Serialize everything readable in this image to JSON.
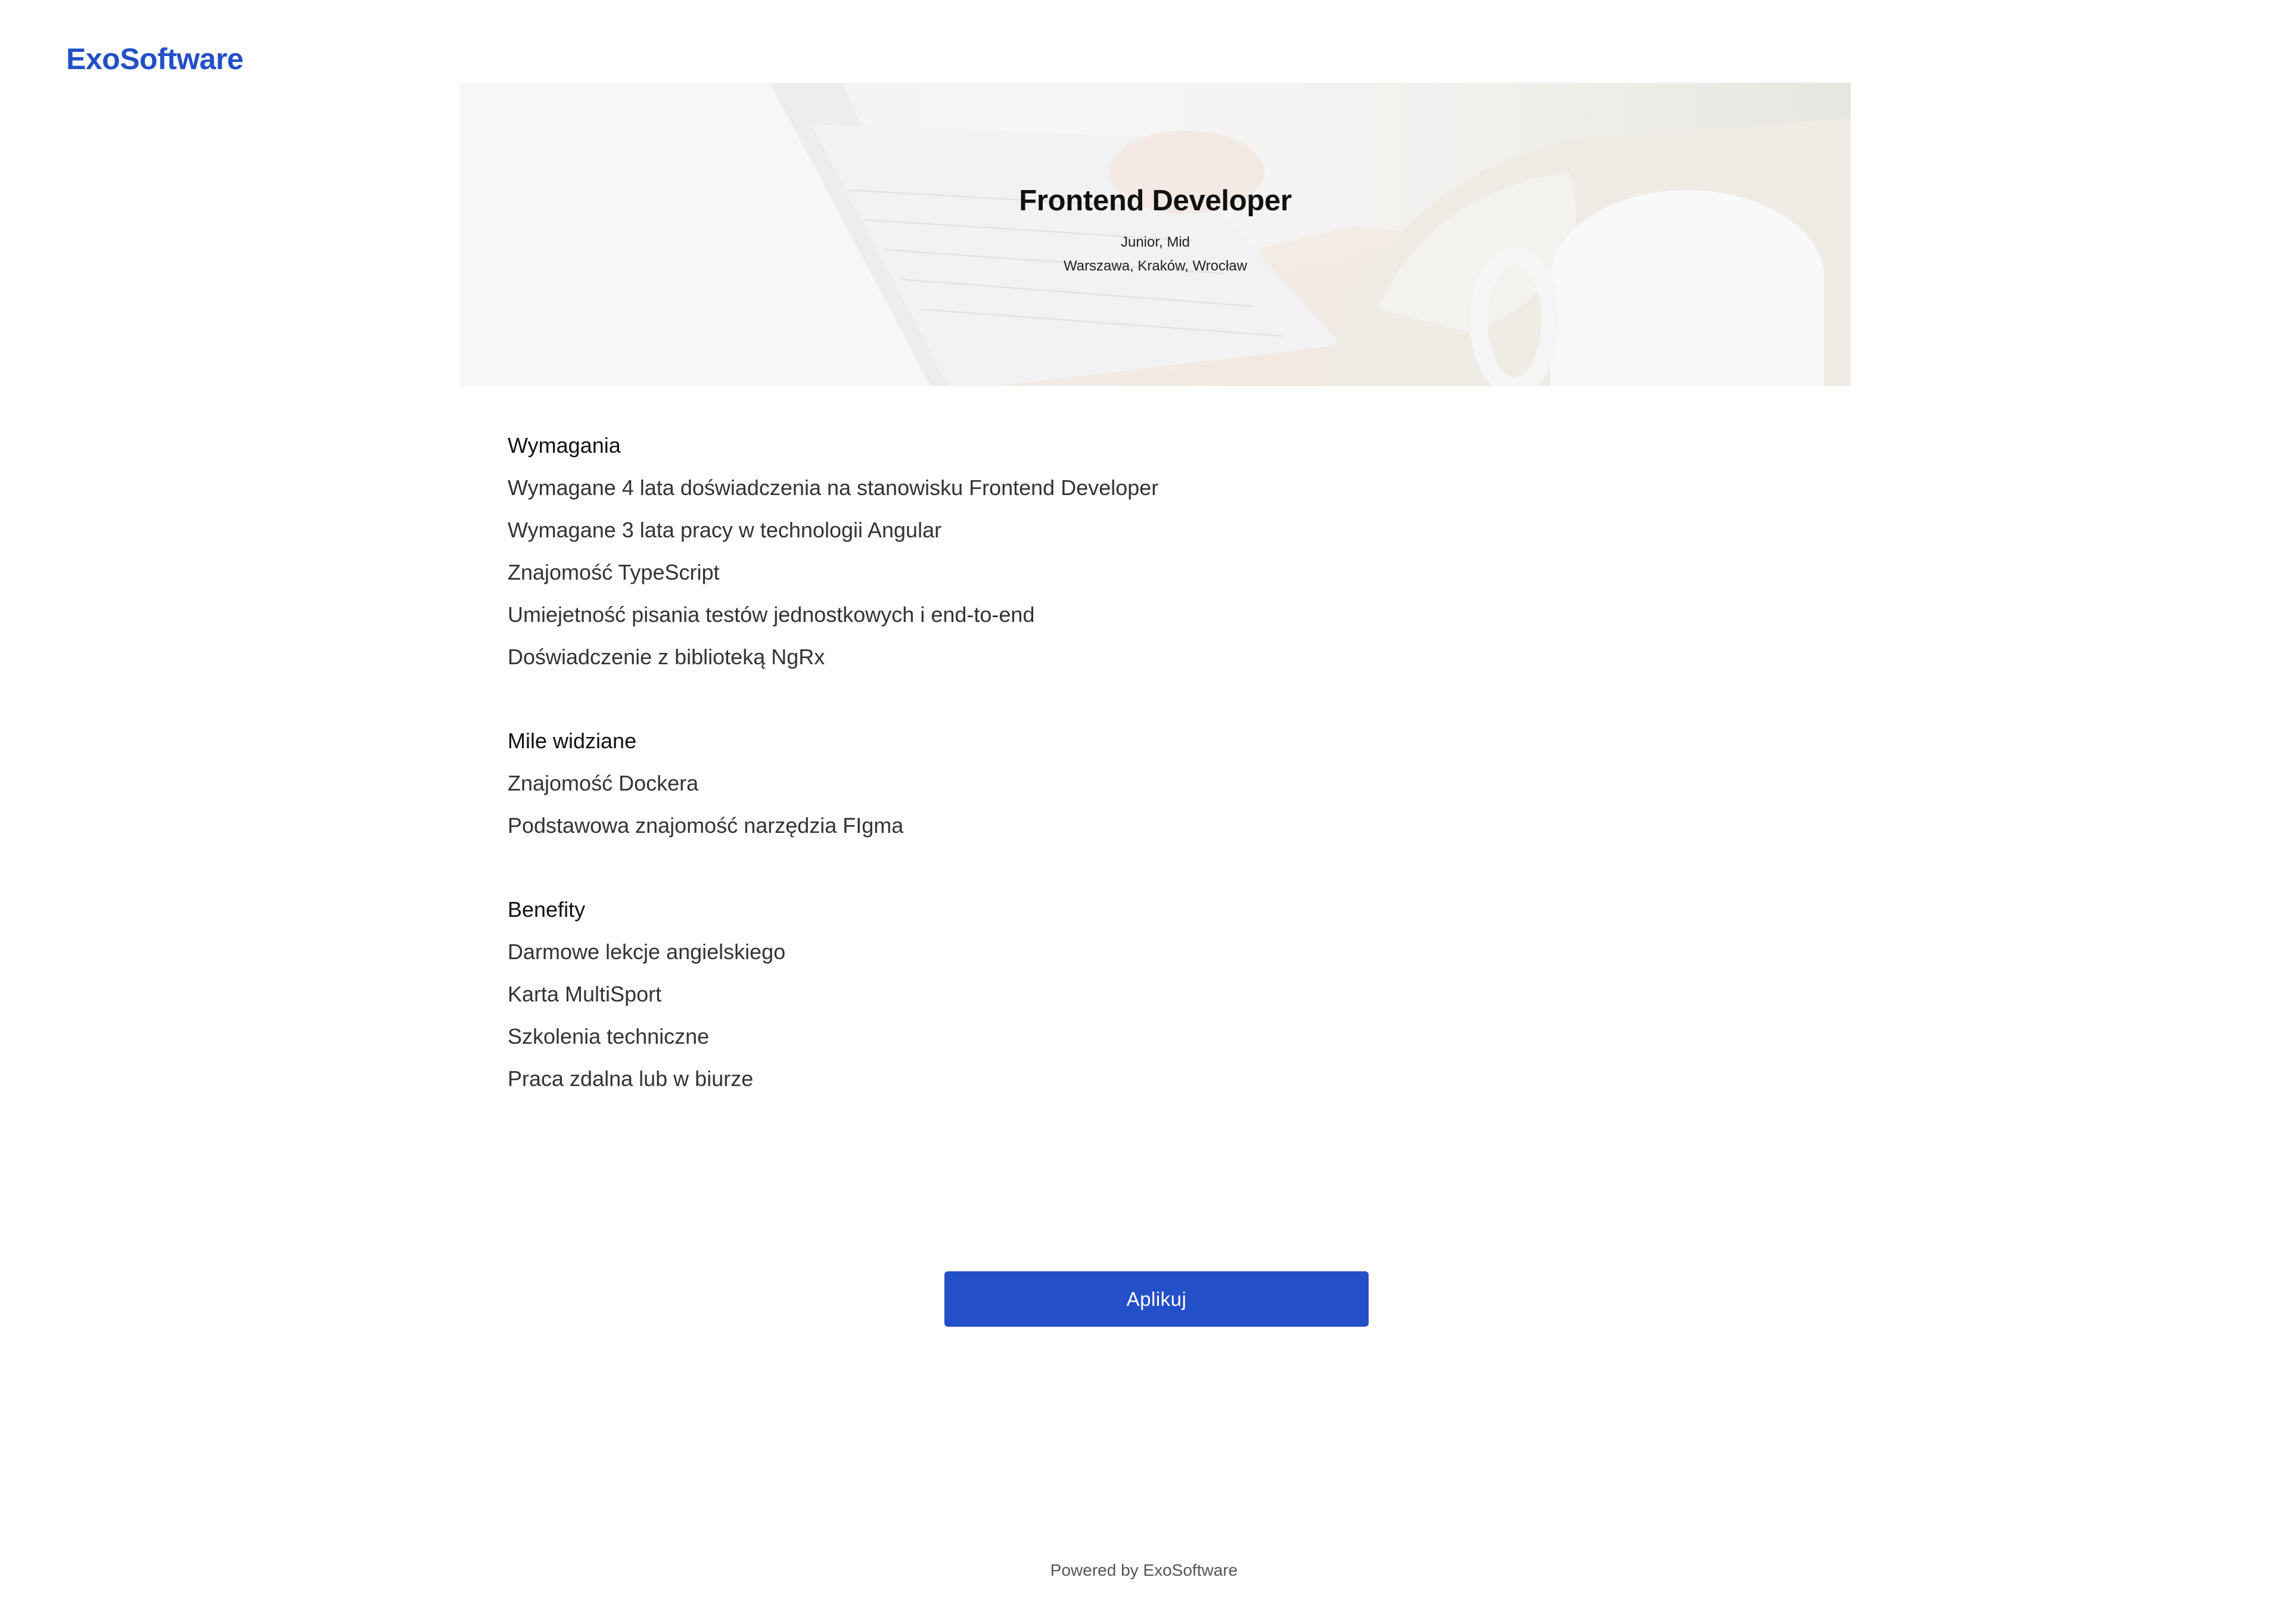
{
  "header": {
    "logo_text": "ExoSoftware"
  },
  "hero": {
    "title": "Frontend Developer",
    "level": "Junior, Mid",
    "locations": "Warszawa, Kraków, Wrocław"
  },
  "sections": [
    {
      "title": "Wymagania",
      "items": [
        "Wymagane 4 lata doświadczenia na stanowisku Frontend Developer",
        "Wymagane 3 lata pracy w technologii Angular",
        "Znajomość TypeScript",
        "Umiejetność pisania testów jednostkowych i end-to-end",
        "Doświadczenie z biblioteką NgRx"
      ]
    },
    {
      "title": "Mile widziane",
      "items": [
        "Znajomość Dockera",
        "Podstawowa znajomość narzędzia FIgma"
      ]
    },
    {
      "title": "Benefity",
      "items": [
        "Darmowe lekcje angielskiego",
        "Karta MultiSport",
        "Szkolenia techniczne",
        "Praca zdalna lub w biurze"
      ]
    }
  ],
  "actions": {
    "apply_label": "Aplikuj"
  },
  "footer": {
    "text": "Powered by ExoSoftware"
  },
  "colors": {
    "brand": "#2350c8",
    "background": "#ffffff"
  }
}
